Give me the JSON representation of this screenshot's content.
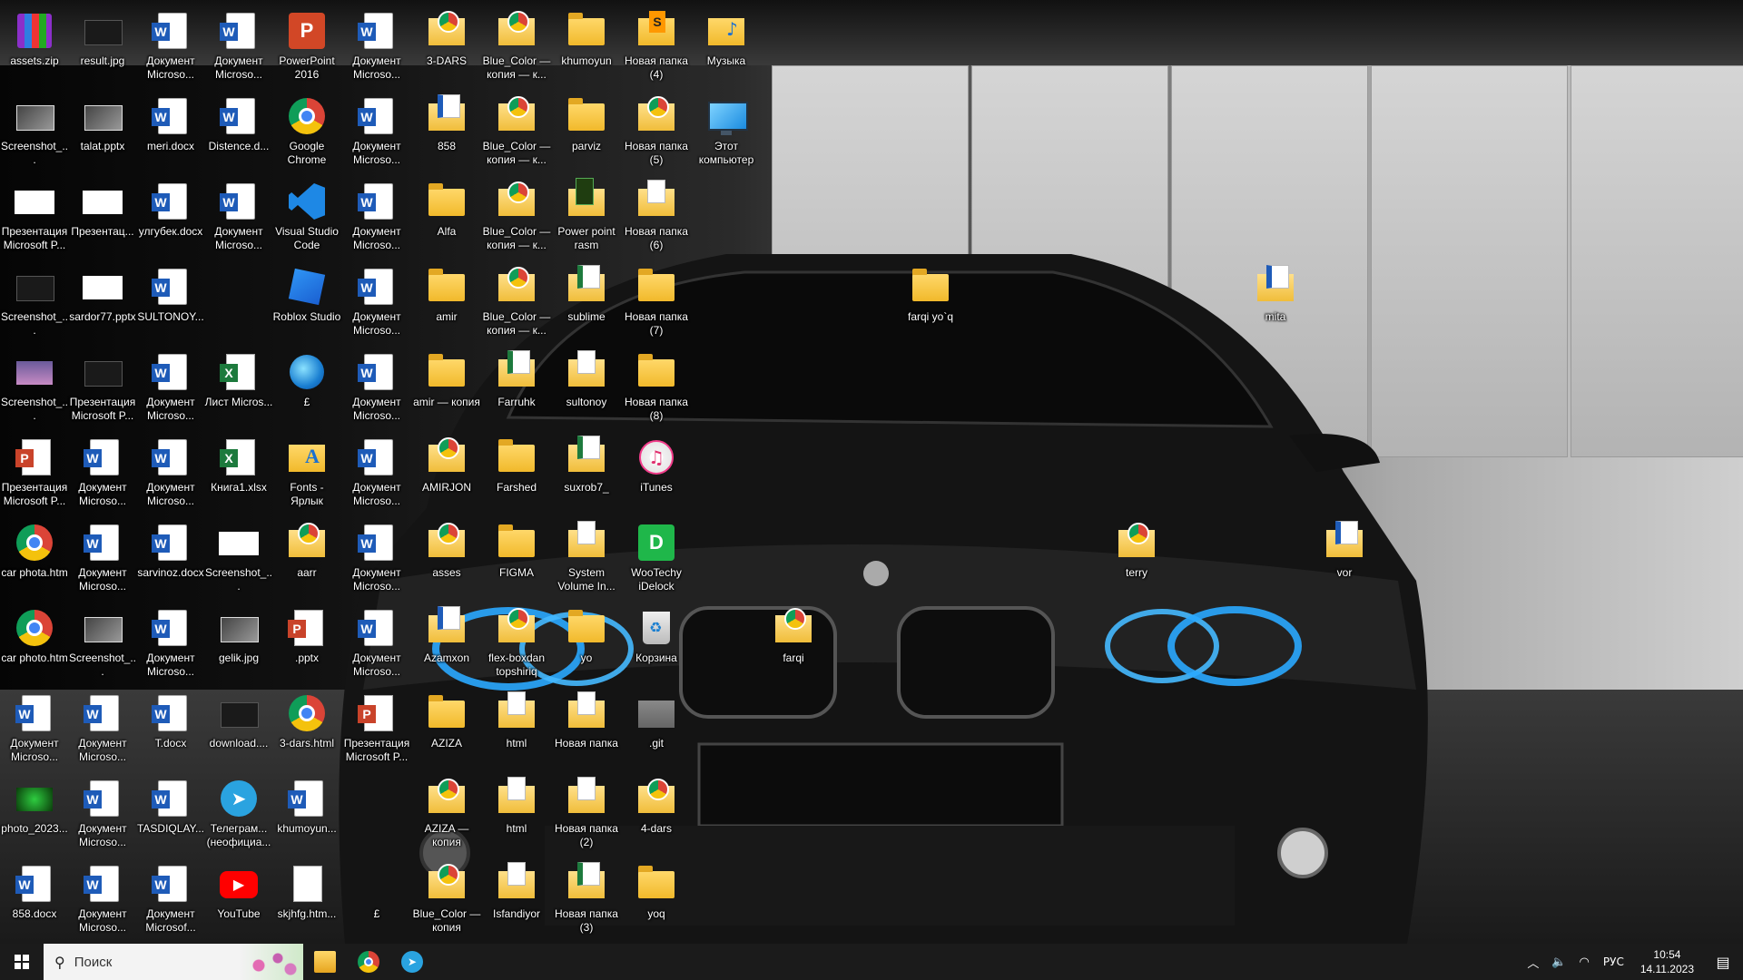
{
  "desktop": {
    "icons": [
      {
        "label": "assets.zip",
        "type": "zip"
      },
      {
        "label": "result.jpg",
        "type": "img-dark"
      },
      {
        "label": "Документ Microso...",
        "type": "word"
      },
      {
        "label": "Документ Microso...",
        "type": "word"
      },
      {
        "label": "PowerPoint 2016",
        "type": "pptapp"
      },
      {
        "label": "Документ Microso...",
        "type": "word"
      },
      {
        "label": "3-DARS",
        "type": "folder-chrome"
      },
      {
        "label": "Blue_Color — копия — к...",
        "type": "folder-chrome"
      },
      {
        "label": "khumoyun",
        "type": "folder"
      },
      {
        "label": "Новая папка (4)",
        "type": "sublime"
      },
      {
        "label": "Музыка",
        "type": "music"
      },
      {
        "label": "Screenshot_...",
        "type": "img"
      },
      {
        "label": "talat.pptx",
        "type": "img"
      },
      {
        "label": "meri.docx",
        "type": "word"
      },
      {
        "label": "Distence.d...",
        "type": "word"
      },
      {
        "label": "Google Chrome",
        "type": "chrome"
      },
      {
        "label": "Документ Microso...",
        "type": "word"
      },
      {
        "label": "858",
        "type": "folder-word"
      },
      {
        "label": "Blue_Color — копия — к...",
        "type": "folder-chrome"
      },
      {
        "label": "parviz",
        "type": "folder"
      },
      {
        "label": "Новая папка (5)",
        "type": "folder-chrome"
      },
      {
        "label": "Этот компьютер",
        "type": "pc"
      },
      {
        "label": "Презентация Microsoft P...",
        "type": "img-white"
      },
      {
        "label": "Презентац...",
        "type": "img-white"
      },
      {
        "label": "улгубек.docx",
        "type": "word"
      },
      {
        "label": "Документ Microso...",
        "type": "word"
      },
      {
        "label": "Visual Studio Code",
        "type": "vscode"
      },
      {
        "label": "Документ Microso...",
        "type": "word"
      },
      {
        "label": "Alfa",
        "type": "folder"
      },
      {
        "label": "Blue_Color — копия — к...",
        "type": "folder-chrome"
      },
      {
        "label": "Power point rasm",
        "type": "folder-green"
      },
      {
        "label": "Новая папка (6)",
        "type": "folder-doc"
      },
      {
        "label": "Screenshot_...",
        "type": "img-dark"
      },
      {
        "label": "sardor77.pptx",
        "type": "img-white"
      },
      {
        "label": "SULTONOY...",
        "type": "word"
      },
      {
        "label": "Roblox Studio",
        "type": "roblox"
      },
      {
        "label": "Документ Microso...",
        "type": "word"
      },
      {
        "label": "amir",
        "type": "folder"
      },
      {
        "label": "Blue_Color — копия — к...",
        "type": "folder-chrome"
      },
      {
        "label": "sublime",
        "type": "excelfolder"
      },
      {
        "label": "Новая папка (7)",
        "type": "folder"
      },
      {
        "label": "farqi yo`q",
        "type": "folder"
      },
      {
        "label": "mita",
        "type": "folder-word"
      },
      {
        "label": "Screenshot_...",
        "type": "img-purple"
      },
      {
        "label": "Презентация Microsoft P...",
        "type": "img-dark"
      },
      {
        "label": "Документ Microso...",
        "type": "word"
      },
      {
        "label": "Лист Micros...",
        "type": "excel"
      },
      {
        "label": "£",
        "type": "edge"
      },
      {
        "label": "Документ Microso...",
        "type": "word"
      },
      {
        "label": "amir — копия",
        "type": "folder"
      },
      {
        "label": "Farruhk",
        "type": "excelfolder"
      },
      {
        "label": "sultonoy",
        "type": "folder-doc"
      },
      {
        "label": "Новая папка (8)",
        "type": "folder"
      },
      {
        "label": "Презентация Microsoft P...",
        "type": "ppt"
      },
      {
        "label": "Документ Microso...",
        "type": "word"
      },
      {
        "label": "Документ Microso...",
        "type": "word"
      },
      {
        "label": "Книга1.xlsx",
        "type": "excel"
      },
      {
        "label": "Fonts - Ярлык",
        "type": "fonts"
      },
      {
        "label": "Документ Microso...",
        "type": "word"
      },
      {
        "label": "AMIRJON",
        "type": "folder-chrome"
      },
      {
        "label": "Farshed",
        "type": "folder"
      },
      {
        "label": "suxrob7_",
        "type": "excelfolder"
      },
      {
        "label": "iTunes",
        "type": "itunes"
      },
      {
        "label": "car phota.htm",
        "type": "chrome"
      },
      {
        "label": "Документ Microso...",
        "type": "word"
      },
      {
        "label": "sarvinoz.docx",
        "type": "word"
      },
      {
        "label": "Screenshot_...",
        "type": "img-white"
      },
      {
        "label": "aarr",
        "type": "folder-chrome"
      },
      {
        "label": "Документ Microso...",
        "type": "word"
      },
      {
        "label": "asses",
        "type": "folder-chrome"
      },
      {
        "label": "FIGMA",
        "type": "folder"
      },
      {
        "label": "System Volume In...",
        "type": "folder-doc"
      },
      {
        "label": "WooTechy iDelock",
        "type": "woo"
      },
      {
        "label": "terry",
        "type": "folder-chrome"
      },
      {
        "label": "vor",
        "type": "folder-word"
      },
      {
        "label": "car photo.htm",
        "type": "chrome"
      },
      {
        "label": "Screenshot_...",
        "type": "img"
      },
      {
        "label": "Документ Microso...",
        "type": "word"
      },
      {
        "label": "gelik.jpg",
        "type": "img"
      },
      {
        "label": ".pptx",
        "type": "ppt"
      },
      {
        "label": "Документ Microso...",
        "type": "word"
      },
      {
        "label": "Azamxon",
        "type": "folder-word"
      },
      {
        "label": "flex-boxdan topshiriq",
        "type": "folder-chrome"
      },
      {
        "label": "yo",
        "type": "folder"
      },
      {
        "label": "Корзина",
        "type": "bin"
      },
      {
        "label": "farqi",
        "type": "folder-chrome"
      },
      {
        "label": "Документ Microso...",
        "type": "word"
      },
      {
        "label": "Документ Microso...",
        "type": "word"
      },
      {
        "label": "T.docx",
        "type": "word"
      },
      {
        "label": "download....",
        "type": "img-dark"
      },
      {
        "label": "3-dars.html",
        "type": "chrome"
      },
      {
        "label": "Презентация Microsoft P...",
        "type": "ppt"
      },
      {
        "label": "AZIZA",
        "type": "folder"
      },
      {
        "label": "html",
        "type": "folder-doc"
      },
      {
        "label": "Новая папка",
        "type": "folder-doc"
      },
      {
        "label": ".git",
        "type": "gitfolder"
      },
      {
        "label": "photo_2023...",
        "type": "img-green"
      },
      {
        "label": "Документ Microso...",
        "type": "word"
      },
      {
        "label": "TASDIQLAY...",
        "type": "word"
      },
      {
        "label": "Телеграм... (неофициа...",
        "type": "tg"
      },
      {
        "label": "khumoyun...",
        "type": "word"
      },
      {
        "label": "AZIZA — копия",
        "type": "folder-chrome"
      },
      {
        "label": "html",
        "type": "folder-doc"
      },
      {
        "label": "Новая папка (2)",
        "type": "folder-doc"
      },
      {
        "label": "4-dars",
        "type": "folder-chrome"
      },
      {
        "label": "858.docx",
        "type": "word"
      },
      {
        "label": "Документ Microso...",
        "type": "word"
      },
      {
        "label": "Документ Microsof...",
        "type": "word"
      },
      {
        "label": "YouTube",
        "type": "yt"
      },
      {
        "label": "skjhfg.htm...",
        "type": "file"
      },
      {
        "label": "£",
        "type": "blank"
      },
      {
        "label": "Blue_Color — копия",
        "type": "folder-chrome"
      },
      {
        "label": "Isfandiyor",
        "type": "folder-doc"
      },
      {
        "label": "Новая папка (3)",
        "type": "excelfolder"
      },
      {
        "label": "yoq",
        "type": "folder"
      }
    ]
  },
  "taskbar": {
    "search_placeholder": "Поиск",
    "pinned": [
      "File Explorer",
      "Google Chrome",
      "Telegram"
    ],
    "language": "РУС",
    "time": "10:54",
    "date": "14.11.2023"
  }
}
